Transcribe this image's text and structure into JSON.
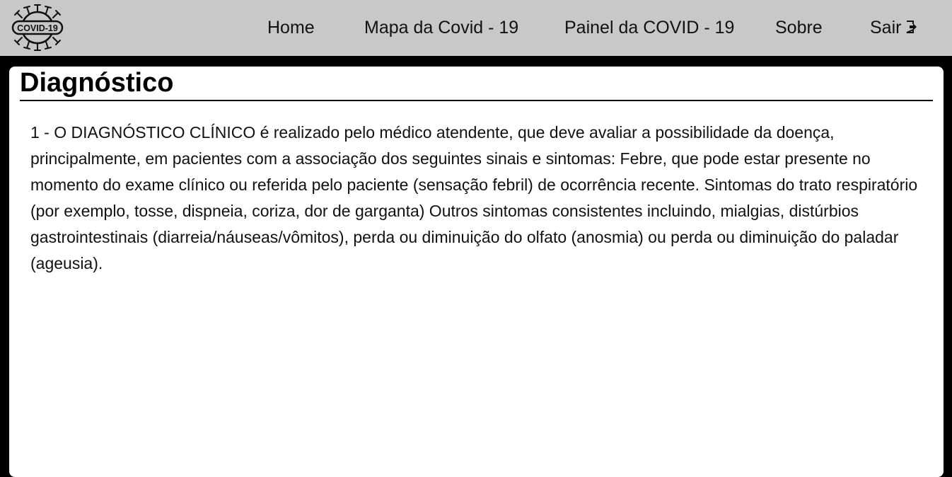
{
  "header": {
    "logo_text": "COVID-19",
    "nav": {
      "home": "Home",
      "mapa": "Mapa da Covid - 19",
      "painel": "Painel da COVID - 19",
      "sobre": "Sobre",
      "sair": "Sair"
    },
    "icons": {
      "logo": "virus-logo",
      "sair": "exit-icon"
    }
  },
  "main": {
    "title": "Diagnóstico",
    "paragraph": "1 - O DIAGNÓSTICO CLÍNICO é realizado pelo médico atendente, que deve avaliar a possibilidade da doença, principalmente, em pacientes com a associação dos seguintes sinais e sintomas: Febre, que pode estar presente no momento do exame clínico ou referida pelo paciente (sensação febril) de ocorrência recente. Sintomas do trato respiratório (por exemplo, tosse, dispneia, coriza, dor de garganta) Outros sintomas consistentes incluindo, mialgias, distúrbios gastrointestinais (diarreia/náuseas/vômitos), perda ou diminuição do olfato (anosmia) ou perda ou diminuição do paladar (ageusia)."
  },
  "colors": {
    "navbar_bg": "#c8c8c8",
    "page_bg": "#000000",
    "card_bg": "#ffffff",
    "text": "#111111"
  }
}
